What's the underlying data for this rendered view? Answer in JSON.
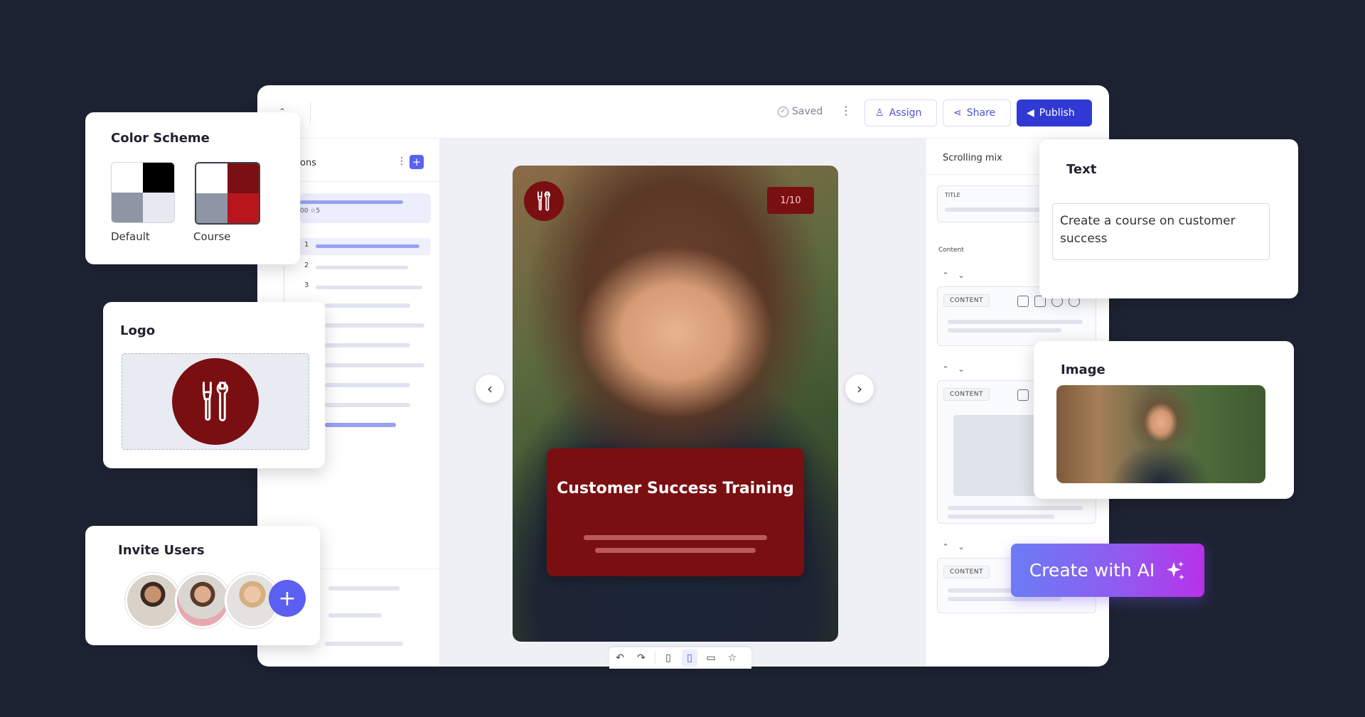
{
  "editor": {
    "saved_label": "Saved",
    "assign_label": "Assign",
    "share_label": "Share",
    "publish_label": "Publish",
    "sidebar_heading": "ons",
    "sidebar_progress": "00 ☆5",
    "sidebar_numbers": [
      "1",
      "2",
      "3"
    ]
  },
  "slide": {
    "counter": "1/10",
    "title": "Customer Success Training"
  },
  "right_panel": {
    "mode_label": "Scrolling mix",
    "title_tag": "TITLE",
    "content_label": "Content",
    "content_tag": "CONTENT"
  },
  "color_scheme": {
    "label": "Color Scheme",
    "options": [
      {
        "name": "Default",
        "colors": [
          "#ffffff",
          "#000000",
          "#8e96a6",
          "#e6e9f0"
        ]
      },
      {
        "name": "Course",
        "colors": [
          "#ffffff",
          "#7a1014",
          "#8e96a6",
          "#b8161c"
        ]
      }
    ]
  },
  "logo_card": {
    "label": "Logo"
  },
  "invite_card": {
    "label": "Invite Users"
  },
  "text_card": {
    "label": "Text",
    "prompt_value": "Create a course on customer success"
  },
  "image_card": {
    "label": "Image"
  },
  "ai_button": {
    "label": "Create with AI"
  },
  "colors": {
    "background": "#1e2333",
    "primary": "#3139d4",
    "brand_red": "#7a0f12",
    "ai_gradient_start": "#6b7cf5",
    "ai_gradient_end": "#b832e8"
  },
  "icons": [
    "check-circle-icon",
    "more-vertical-icon",
    "assign-user-icon",
    "share-icon",
    "publish-megaphone-icon",
    "plus-icon",
    "tools-icon",
    "chevron-left-icon",
    "chevron-right-icon",
    "undo-icon",
    "redo-icon",
    "phone-icon",
    "tablet-icon",
    "desktop-icon",
    "star-icon",
    "sparkle-icon"
  ]
}
